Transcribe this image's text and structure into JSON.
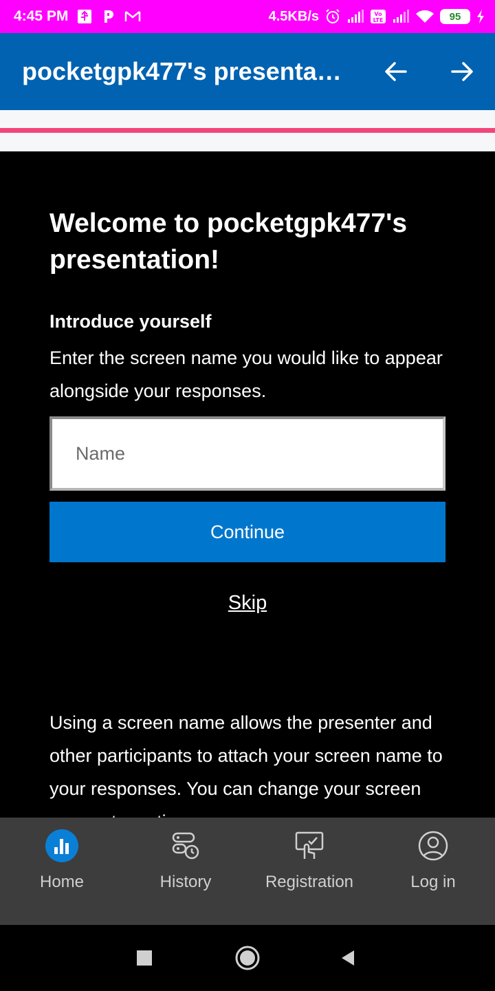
{
  "status_bar": {
    "time": "4:45 PM",
    "network_speed": "4.5KB/s",
    "battery_level": "95",
    "icons": [
      "usb-icon",
      "p-icon",
      "gmail-icon",
      "alarm-icon",
      "signal-icon",
      "volte-icon",
      "signal-icon",
      "wifi-icon",
      "battery-icon",
      "charging-icon"
    ]
  },
  "app_bar": {
    "title": "pocketgpk477's presenta…",
    "back_icon": "arrow-left-icon",
    "forward_icon": "arrow-right-icon"
  },
  "colors": {
    "status_bar": "#ff00ff",
    "app_bar": "#0062b1",
    "progress_line": "#f1467b",
    "primary_button": "#0077cc",
    "bottom_nav": "#3d3d3d",
    "home_active": "#0a7fd6"
  },
  "content": {
    "welcome": "Welcome to pocketgpk477's presentation!",
    "intro_title": "Introduce yourself",
    "intro_description": "Enter the screen name you would like to appear alongside your responses.",
    "name_placeholder": "Name",
    "name_value": "",
    "continue_label": "Continue",
    "skip_label": "Skip",
    "info_text": "Using a screen name allows the presenter and other participants to attach your screen name to your responses. You can change your screen name at any time."
  },
  "bottom_nav": {
    "tabs": [
      {
        "label": "Home",
        "icon": "bar-chart-icon",
        "active": true
      },
      {
        "label": "History",
        "icon": "history-icon",
        "active": false
      },
      {
        "label": "Registration",
        "icon": "registration-icon",
        "active": false
      },
      {
        "label": "Log in",
        "icon": "user-icon",
        "active": false
      }
    ]
  },
  "system_nav": {
    "icons": [
      "recents-icon",
      "home-icon",
      "back-icon"
    ]
  }
}
